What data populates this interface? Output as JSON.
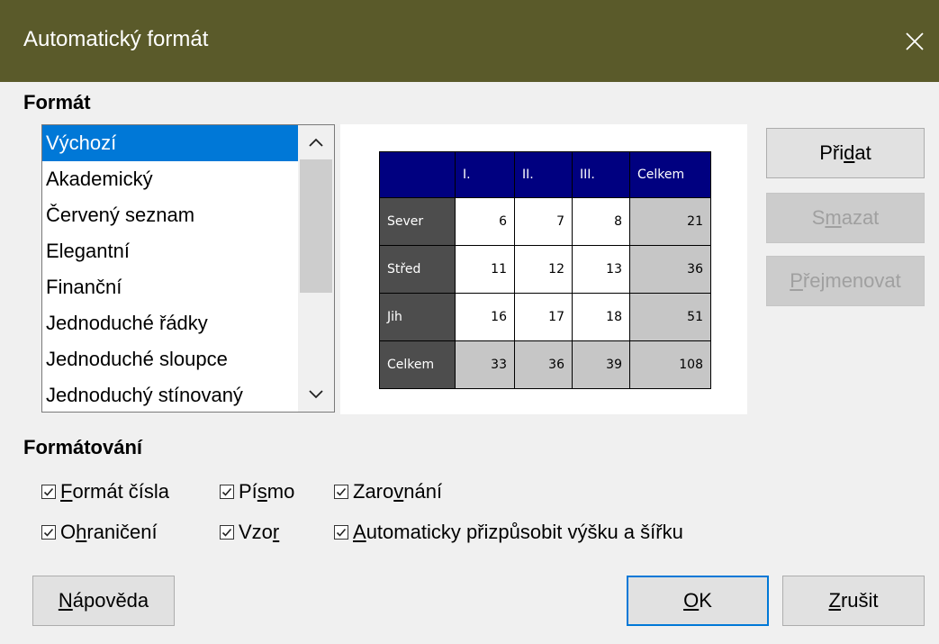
{
  "window": {
    "title": "Automatický formát"
  },
  "sections": {
    "format": "Formát",
    "formatting": "Formátování"
  },
  "format_list": {
    "items": [
      "Výchozí",
      "Akademický",
      "Červený seznam",
      "Elegantní",
      "Finanční",
      "Jednoduché řádky",
      "Jednoduché sloupce",
      "Jednoduchý stínovaný"
    ],
    "selected": "Výchozí"
  },
  "preview": {
    "header": [
      "",
      "I.",
      "II.",
      "III.",
      "Celkem"
    ],
    "rows": [
      {
        "label": "Sever",
        "values": [
          "6",
          "7",
          "8"
        ],
        "total": "21"
      },
      {
        "label": "Střed",
        "values": [
          "11",
          "12",
          "13"
        ],
        "total": "36"
      },
      {
        "label": "Jih",
        "values": [
          "16",
          "17",
          "18"
        ],
        "total": "51"
      },
      {
        "label": "Celkem",
        "values": [
          "33",
          "36",
          "39"
        ],
        "total": "108"
      }
    ]
  },
  "buttons": {
    "add": {
      "pre": "Při",
      "key": "d",
      "post": "at"
    },
    "delete": {
      "pre": "S",
      "key": "m",
      "post": "azat"
    },
    "rename": {
      "pre": "",
      "key": "P",
      "post": "řejmenovat"
    },
    "help": {
      "pre": "",
      "key": "N",
      "post": "ápověda"
    },
    "ok": {
      "pre": "",
      "key": "O",
      "post": "K"
    },
    "cancel": {
      "pre": "",
      "key": "Z",
      "post": "rušit"
    }
  },
  "checkboxes": {
    "number_format": {
      "pre": "",
      "key": "F",
      "post": "ormát čísla",
      "checked": true
    },
    "font": {
      "pre": "Pí",
      "key": "s",
      "post": "mo",
      "checked": true
    },
    "alignment": {
      "pre": "Zaro",
      "key": "v",
      "post": "nání",
      "checked": true
    },
    "borders": {
      "pre": "O",
      "key": "h",
      "post": "raničení",
      "checked": true
    },
    "pattern": {
      "pre": "Vzo",
      "key": "r",
      "post": "",
      "checked": true
    },
    "autofit": {
      "pre": "",
      "key": "A",
      "post": "utomaticky přizpůsobit výšku a šířku",
      "checked": true
    }
  },
  "colors": {
    "titlebar": "#5a5a2a",
    "selection": "#0078d7",
    "preview_header": "#000080",
    "preview_row_label": "#4d4d4d",
    "preview_total": "#c6c6c6"
  }
}
